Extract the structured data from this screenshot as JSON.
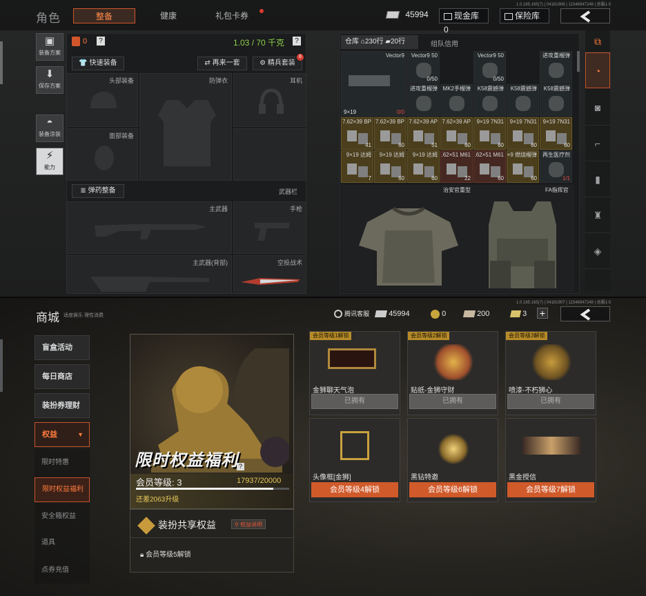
{
  "top": {
    "title": "角色",
    "tabs": [
      {
        "label": "整备",
        "active": true
      },
      {
        "label": "健康",
        "active": false
      },
      {
        "label": "礼包卡券",
        "active": false
      }
    ],
    "version": "1.0.165.165(7) | 04181906 | 11546947249 | 总服1-5",
    "currency": "45994",
    "cash_vault": "现金库 0",
    "safebox": "保险库",
    "side_buttons": [
      {
        "icon": "backpack-icon",
        "label": "装备方案"
      },
      {
        "icon": "download-icon",
        "label": "保存方案"
      },
      {
        "icon": "helmet-icon",
        "label": "装备涂装"
      },
      {
        "icon": "power-icon",
        "label": "能力"
      }
    ],
    "weight_icon_value": "0",
    "weight": "1.03 / 70 千克",
    "buttons": {
      "quick": "快速装备",
      "again": "再来一套",
      "elite": "精兵套装",
      "elite_badge": "6",
      "ammo": "弹药整备"
    },
    "slots": {
      "head": "头部装备",
      "armor": "防弹衣",
      "ear": "耳机",
      "face": "面部装备",
      "weapon_bar": "武器栏",
      "primary": "主武器",
      "pistol": "手枪",
      "primary_back": "主武器(背部)",
      "melee": "空投战术"
    },
    "storage": {
      "tab_warehouse": "仓库",
      "rows": "230行",
      "rows2": "20行",
      "tab_team": "组队信用"
    },
    "grid": [
      {
        "c": 0,
        "r": 0,
        "w": 2,
        "h": 2,
        "name": "Vector9",
        "qty": "0/0",
        "extra": "9×19",
        "kind": "g",
        "red": true
      },
      {
        "c": 2,
        "r": 0,
        "w": 1,
        "h": 1,
        "name": "Vector9 50",
        "qty": "0/50",
        "kind": "g"
      },
      {
        "c": 4,
        "r": 0,
        "w": 1,
        "h": 1,
        "name": "Vector9 50",
        "qty": "0/50",
        "kind": "g"
      },
      {
        "c": 6,
        "r": 0,
        "w": 1,
        "h": 1,
        "name": "进攻重榴弹",
        "qty": "",
        "kind": "g"
      },
      {
        "c": 2,
        "r": 1,
        "w": 1,
        "h": 1,
        "name": "进攻重榴弹",
        "qty": "",
        "kind": "g"
      },
      {
        "c": 3,
        "r": 1,
        "w": 1,
        "h": 1,
        "name": "MK2手榴弹",
        "qty": "",
        "kind": "g"
      },
      {
        "c": 4,
        "r": 1,
        "w": 1,
        "h": 1,
        "name": "K58震撼弹",
        "qty": "",
        "kind": "g"
      },
      {
        "c": 5,
        "r": 1,
        "w": 1,
        "h": 1,
        "name": "K58震撼弹",
        "qty": "",
        "kind": "g"
      },
      {
        "c": 6,
        "r": 1,
        "w": 1,
        "h": 1,
        "name": "K58震撼弹",
        "qty": "",
        "kind": "g"
      },
      {
        "c": 0,
        "r": 2,
        "w": 1,
        "h": 1,
        "name": "7.62×39 BP",
        "qty": "41",
        "kind": "y"
      },
      {
        "c": 1,
        "r": 2,
        "w": 1,
        "h": 1,
        "name": "7.62×39 BP",
        "qty": "60",
        "kind": "y"
      },
      {
        "c": 2,
        "r": 2,
        "w": 1,
        "h": 1,
        "name": "7.62×39 AP",
        "qty": "51",
        "kind": "y"
      },
      {
        "c": 3,
        "r": 2,
        "w": 1,
        "h": 1,
        "name": "7.62×39 AP",
        "qty": "60",
        "kind": "y"
      },
      {
        "c": 4,
        "r": 2,
        "w": 1,
        "h": 1,
        "name": "9×19 7N31",
        "qty": "60",
        "kind": "y"
      },
      {
        "c": 5,
        "r": 2,
        "w": 1,
        "h": 1,
        "name": "9×19 7N31",
        "qty": "60",
        "kind": "y"
      },
      {
        "c": 6,
        "r": 2,
        "w": 1,
        "h": 1,
        "name": "9×19 7N31",
        "qty": "60",
        "kind": "y"
      },
      {
        "c": 0,
        "r": 3,
        "w": 1,
        "h": 1,
        "name": "9×19 达姆",
        "qty": "7",
        "kind": "y"
      },
      {
        "c": 1,
        "r": 3,
        "w": 1,
        "h": 1,
        "name": "9×19 达姆",
        "qty": "60",
        "kind": "y"
      },
      {
        "c": 2,
        "r": 3,
        "w": 1,
        "h": 1,
        "name": "9×19 达姆",
        "qty": "60",
        "kind": "y"
      },
      {
        "c": 3,
        "r": 3,
        "w": 1,
        "h": 1,
        "name": "7.62×51 M61",
        "qty": "22",
        "kind": "r"
      },
      {
        "c": 4,
        "r": 3,
        "w": 1,
        "h": 1,
        "name": "7.62×51 M61",
        "qty": "60",
        "kind": "r"
      },
      {
        "c": 5,
        "r": 3,
        "w": 1,
        "h": 1,
        "name": "35×9 燃烧榴弹",
        "qty": "60",
        "kind": "y"
      },
      {
        "c": 6,
        "r": 3,
        "w": 1,
        "h": 1,
        "name": "再生医疗剂",
        "qty": "1/1",
        "kind": "g",
        "red": true
      }
    ],
    "armor_items": [
      "治安官重型",
      "FA指挥官"
    ]
  },
  "bottom": {
    "title": "商城",
    "subtitle": "适度娱乐 理性消费",
    "version": "1.0.165.165(7) | 04181907 | 11546947249 | 总服1-5",
    "service": "腾讯客服",
    "currencies": [
      {
        "icon": "money-icon",
        "value": "45994"
      },
      {
        "icon": "coin-icon",
        "value": "0"
      },
      {
        "icon": "ticket-icon",
        "value": "200"
      },
      {
        "icon": "voucher-icon",
        "value": "3"
      }
    ],
    "nav": [
      {
        "label": "盲盒活动",
        "type": "main"
      },
      {
        "label": "每日商店",
        "type": "main"
      },
      {
        "label": "装扮券理财",
        "type": "main"
      },
      {
        "label": "权益",
        "type": "main-open"
      },
      {
        "label": "限时特惠",
        "type": "sub"
      },
      {
        "label": "限时权益福利",
        "type": "sub-sel"
      },
      {
        "label": "安全箱权益",
        "type": "sub"
      },
      {
        "label": "道具",
        "type": "sub"
      },
      {
        "label": "点券充值",
        "type": "sub"
      }
    ],
    "banner": {
      "title": "限时权益福利",
      "level_label": "会员等级: 3",
      "progress": "17937/20000",
      "progress_fraction": 0.897,
      "upgrade": "还差2063升级",
      "share_title": "装扮共享权益",
      "share_btn": "权益说明",
      "locked": "会员等级5解锁"
    },
    "cards": [
      {
        "tag": "会员等级1解锁",
        "name": "金狮聊天气泡",
        "btn": "已拥有",
        "owned": true
      },
      {
        "tag": "会员等级2解锁",
        "name": "贴纸-金狮守财",
        "btn": "已拥有",
        "owned": true
      },
      {
        "tag": "会员等级3解锁",
        "name": "喷漆-不朽狮心",
        "btn": "已拥有",
        "owned": true
      },
      {
        "tag": "",
        "name": "头像框[金狮]",
        "btn": "会员等级4解锁",
        "owned": false
      },
      {
        "tag": "",
        "name": "黑钻特邀",
        "btn": "会员等级6解锁",
        "owned": false
      },
      {
        "tag": "",
        "name": "黑金授信",
        "btn": "会员等级7解锁",
        "owned": false
      }
    ]
  }
}
